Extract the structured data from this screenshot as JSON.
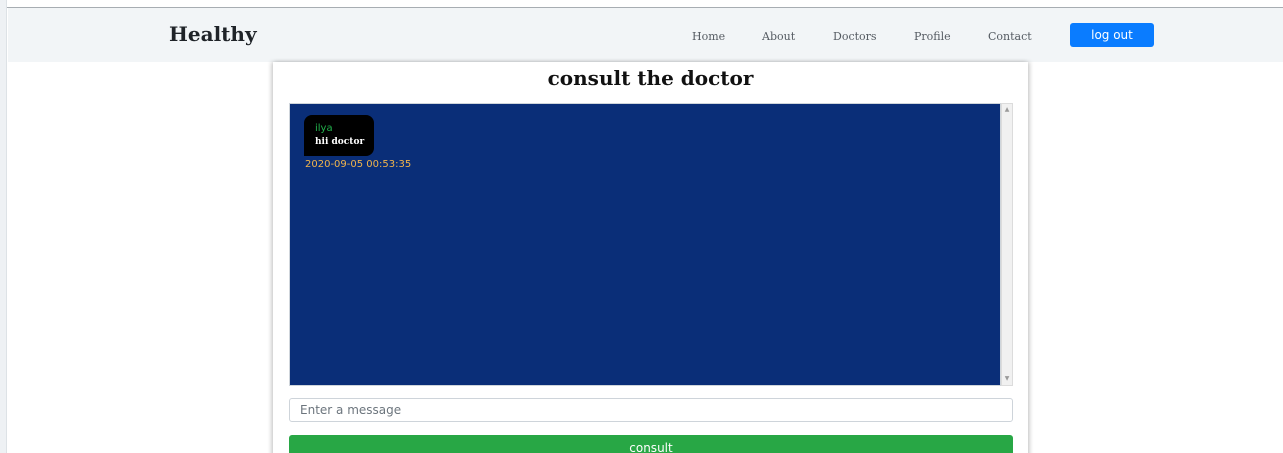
{
  "navbar": {
    "brand": "Healthy",
    "links": [
      {
        "label": "Home"
      },
      {
        "label": "About"
      },
      {
        "label": "Doctors"
      },
      {
        "label": "Profile"
      },
      {
        "label": "Contact"
      }
    ],
    "logout_label": "log out"
  },
  "consult": {
    "title": "consult the doctor",
    "messages": [
      {
        "sender": "ilya",
        "text": "hii doctor",
        "timestamp": "2020-09-05 00:53:35"
      }
    ],
    "input_placeholder": "Enter a message",
    "submit_label": "consult"
  },
  "colors": {
    "chat_background": "#0a2e78",
    "sender_name": "#22b14c",
    "timestamp": "#f0b44c",
    "logout_button": "#0a7cff",
    "consult_button": "#28a745"
  }
}
